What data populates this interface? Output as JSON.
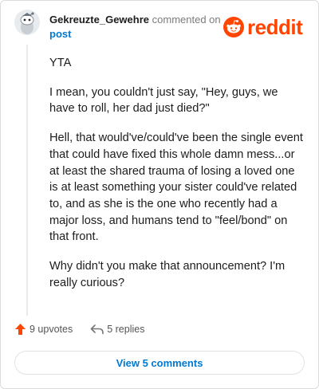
{
  "header": {
    "username": "Gekreuzte_Gewehre",
    "action_text": "commented on",
    "post_link": "post",
    "brand_name": "reddit",
    "brand_color": "#ff4500",
    "avatar_icon": "snoo-avatar-icon"
  },
  "comment": {
    "paragraphs": [
      "YTA",
      "I mean, you couldn't just say, \"Hey, guys, we have to roll, her dad just died?\"",
      "Hell, that would've/could've been the single event that could have fixed this whole damn mess...or at least the shared trauma of losing a loved one is at least something your sister could've related to, and as she is the one who recently had a major loss, and humans tend to \"feel/bond\" on that front.",
      "Why didn't you make that announcement? I'm really curious?"
    ]
  },
  "footer": {
    "upvotes_label": "9 upvotes",
    "replies_label": "5 replies",
    "view_button": "View 5 comments",
    "upvote_icon": "upvote-arrow-icon",
    "reply_icon": "reply-arrow-icon",
    "upvote_color": "#ff4500",
    "link_color": "#0079d3"
  }
}
